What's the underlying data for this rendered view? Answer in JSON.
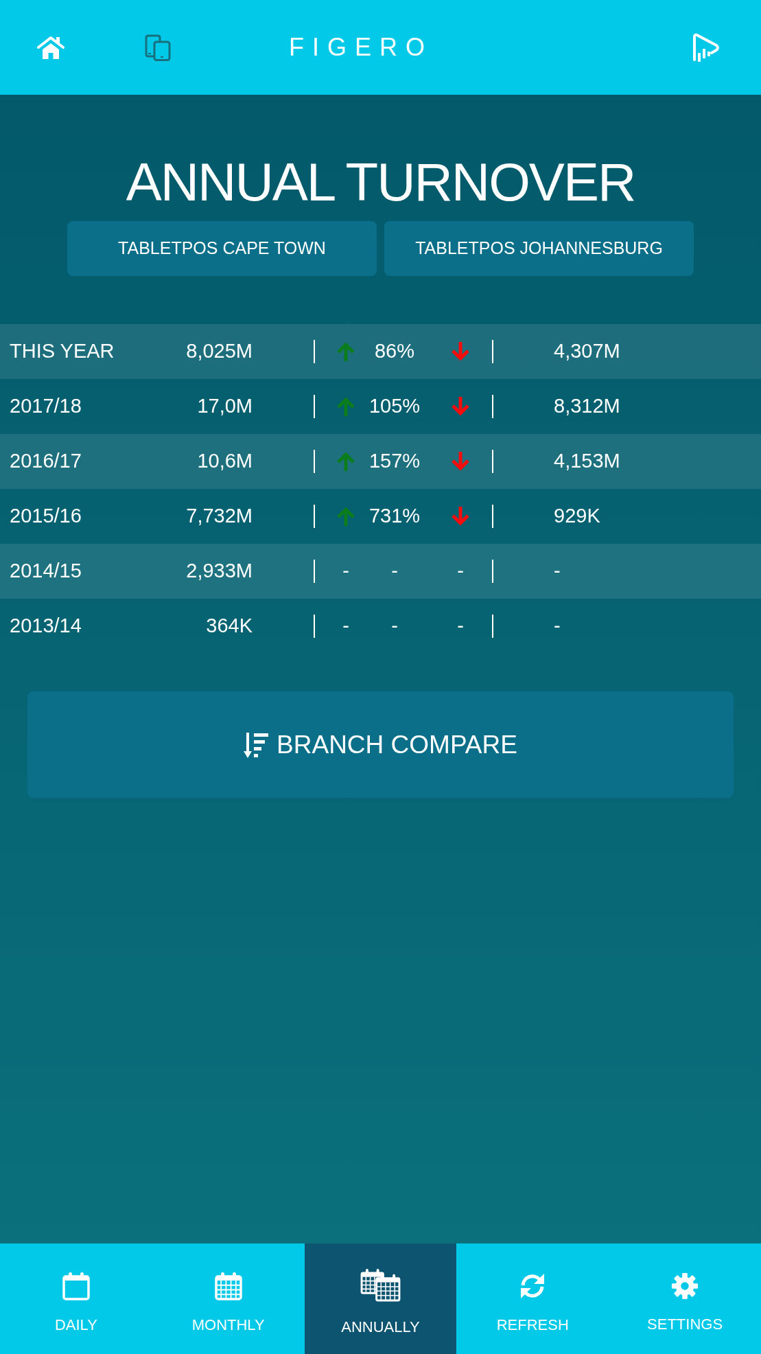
{
  "header": {
    "logo": "FIGERO"
  },
  "title": "ANNUAL TURNOVER",
  "branches": [
    {
      "label": "TABLETPOS CAPE TOWN"
    },
    {
      "label": "TABLETPOS JOHANNESBURG"
    }
  ],
  "turnover_table": {
    "rows": [
      {
        "period": "THIS YEAR",
        "turnover": "8,025M",
        "rise": {
          "kind": "arrow-up"
        },
        "change": "86%",
        "fall": {
          "kind": "arrow-down"
        },
        "compare": "4,307M"
      },
      {
        "period": "2017/18",
        "turnover": "17,0M",
        "rise": {
          "kind": "arrow-up"
        },
        "change": "105%",
        "fall": {
          "kind": "arrow-down"
        },
        "compare": "8,312M"
      },
      {
        "period": "2016/17",
        "turnover": "10,6M",
        "rise": {
          "kind": "arrow-up"
        },
        "change": "157%",
        "fall": {
          "kind": "arrow-down"
        },
        "compare": "4,153M"
      },
      {
        "period": "2015/16",
        "turnover": "7,732M",
        "rise": {
          "kind": "arrow-up"
        },
        "change": "731%",
        "fall": {
          "kind": "arrow-down"
        },
        "compare": "929K"
      },
      {
        "period": "2014/15",
        "turnover": "2,933M",
        "rise": {
          "kind": "dash",
          "text": "-"
        },
        "change": "-",
        "fall": {
          "kind": "dash",
          "text": "-"
        },
        "compare": "-"
      },
      {
        "period": "2013/14",
        "turnover": "364K",
        "rise": {
          "kind": "dash",
          "text": "-"
        },
        "change": "-",
        "fall": {
          "kind": "dash",
          "text": "-"
        },
        "compare": "-"
      }
    ]
  },
  "compare_button": {
    "label": "BRANCH COMPARE"
  },
  "bottom_nav": [
    {
      "label": "DAILY",
      "selected": false
    },
    {
      "label": "MONTHLY",
      "selected": false
    },
    {
      "label": "ANNUALLY",
      "selected": true
    },
    {
      "label": "REFRESH",
      "selected": false
    },
    {
      "label": "SETTINGS",
      "selected": false
    }
  ]
}
